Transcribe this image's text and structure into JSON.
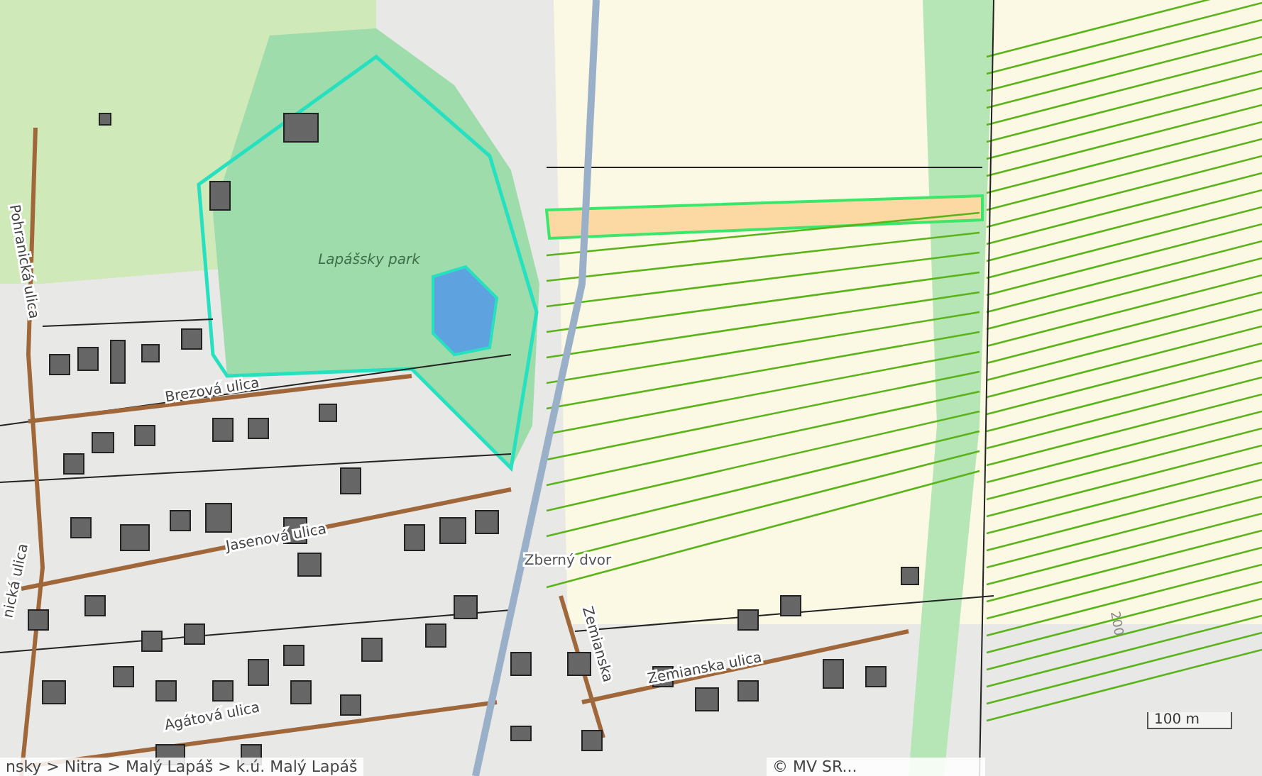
{
  "map": {
    "labels": [
      {
        "kind": "park",
        "text": "Lapášsky park"
      },
      {
        "kind": "street",
        "text": "Pohranická ulica"
      },
      {
        "kind": "street",
        "text": "Brezová ulica"
      },
      {
        "kind": "street",
        "text": "Jasenová ulica"
      },
      {
        "kind": "street",
        "text": "nická ulica"
      },
      {
        "kind": "poi",
        "text": "Zberný dvor"
      },
      {
        "kind": "street",
        "text": "Zemianska"
      },
      {
        "kind": "street",
        "text": "Zemianska ulica"
      },
      {
        "kind": "street",
        "text": "Agátová ulica"
      },
      {
        "kind": "contour",
        "text": "200"
      }
    ]
  },
  "scale_bar": {
    "text": "100 m"
  },
  "breadcrumb": "nsky > Nitra > Malý Lapáš > k.ú. Malý Lapáš",
  "attribution": "© MV SR..."
}
